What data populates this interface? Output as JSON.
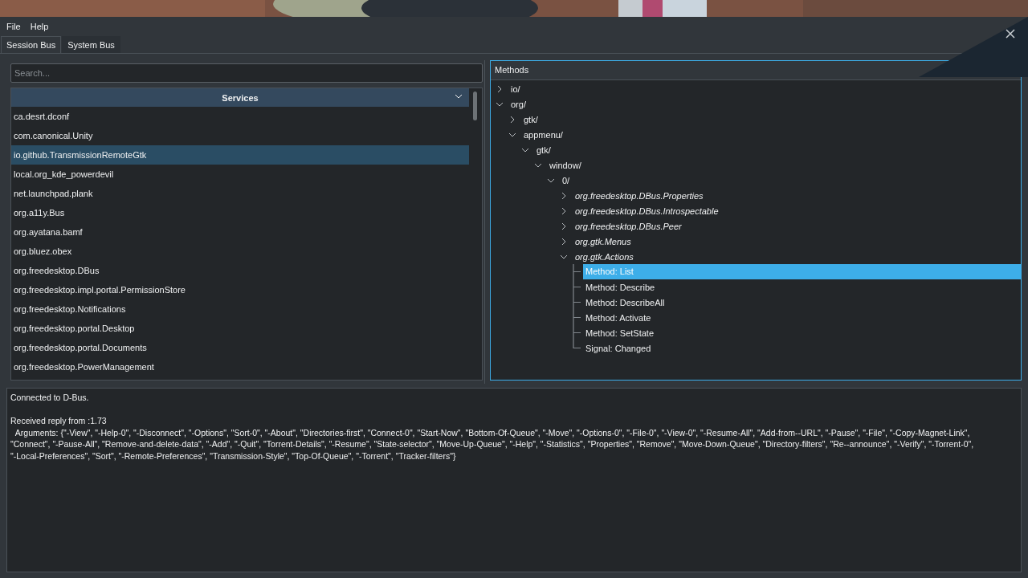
{
  "menu": [
    "File",
    "Help"
  ],
  "tabs": [
    {
      "label": "Session Bus",
      "selected": true
    },
    {
      "label": "System Bus",
      "selected": false
    }
  ],
  "search": {
    "placeholder": "Search..."
  },
  "services": {
    "header": "Services",
    "items": [
      {
        "name": "ca.desrt.dconf",
        "selected": false
      },
      {
        "name": "com.canonical.Unity",
        "selected": false
      },
      {
        "name": "io.github.TransmissionRemoteGtk",
        "selected": true
      },
      {
        "name": "local.org_kde_powerdevil",
        "selected": false
      },
      {
        "name": "net.launchpad.plank",
        "selected": false
      },
      {
        "name": "org.a11y.Bus",
        "selected": false
      },
      {
        "name": "org.ayatana.bamf",
        "selected": false
      },
      {
        "name": "org.bluez.obex",
        "selected": false
      },
      {
        "name": "org.freedesktop.DBus",
        "selected": false
      },
      {
        "name": "org.freedesktop.impl.portal.PermissionStore",
        "selected": false
      },
      {
        "name": "org.freedesktop.Notifications",
        "selected": false
      },
      {
        "name": "org.freedesktop.portal.Desktop",
        "selected": false
      },
      {
        "name": "org.freedesktop.portal.Documents",
        "selected": false
      },
      {
        "name": "org.freedesktop.PowerManagement",
        "selected": false
      }
    ]
  },
  "methods": {
    "header": "Methods",
    "tree": [
      {
        "label": "io/",
        "kind": "node",
        "expanded": false
      },
      {
        "label": "org/",
        "kind": "node",
        "expanded": true,
        "children": [
          {
            "label": "gtk/",
            "kind": "node",
            "expanded": false
          },
          {
            "label": "appmenu/",
            "kind": "node",
            "expanded": true,
            "children": [
              {
                "label": "gtk/",
                "kind": "node",
                "expanded": true,
                "children": [
                  {
                    "label": "window/",
                    "kind": "node",
                    "expanded": true,
                    "children": [
                      {
                        "label": "0/",
                        "kind": "node",
                        "expanded": true,
                        "children": [
                          {
                            "label": "org.freedesktop.DBus.Properties",
                            "kind": "interface",
                            "expanded": false
                          },
                          {
                            "label": "org.freedesktop.DBus.Introspectable",
                            "kind": "interface",
                            "expanded": false
                          },
                          {
                            "label": "org.freedesktop.DBus.Peer",
                            "kind": "interface",
                            "expanded": false
                          },
                          {
                            "label": "org.gtk.Menus",
                            "kind": "interface",
                            "expanded": false
                          },
                          {
                            "label": "org.gtk.Actions",
                            "kind": "interface",
                            "expanded": true,
                            "children": [
                              {
                                "label": "Method: List",
                                "kind": "member",
                                "selected": true
                              },
                              {
                                "label": "Method: Describe",
                                "kind": "member",
                                "selected": false
                              },
                              {
                                "label": "Method: DescribeAll",
                                "kind": "member",
                                "selected": false
                              },
                              {
                                "label": "Method: Activate",
                                "kind": "member",
                                "selected": false
                              },
                              {
                                "label": "Method: SetState",
                                "kind": "member",
                                "selected": false
                              },
                              {
                                "label": "Signal: Changed",
                                "kind": "member",
                                "selected": false
                              }
                            ]
                          }
                        ]
                      }
                    ]
                  }
                ]
              }
            ]
          }
        ]
      }
    ]
  },
  "log": [
    [
      "Connected to D-Bus."
    ],
    [
      "Received reply from :1.73",
      "  Arguments: {\"-View\", \"-Help-0\", \"-Disconnect\", \"-Options\", \"Sort-0\", \"-About\", \"Directories-first\", \"Connect-0\", \"Start-Now\", \"Bottom-Of-Queue\", \"-Move\", \"-Options-0\", \"-File-0\", \"-View-0\", \"-Resume-All\", \"Add-from--URL\", \"-Pause\", \"-File\", \"-Copy-Magnet-Link\",",
      "\"Connect\", \"-Pause-All\", \"Remove-and-delete-data\", \"-Add\", \"-Quit\", \"Torrent-Details\", \"-Resume\", \"State-selector\", \"Move-Up-Queue\", \"-Help\", \"-Statistics\", \"Properties\", \"Remove\", \"Move-Down-Queue\", \"Directory-filters\", \"Re--announce\", \"-Verify\", \"-Torrent-0\",",
      "\"-Local-Preferences\", \"Sort\", \"-Remote-Preferences\", \"Transmission-Style\", \"Top-Of-Queue\", \"-Torrent\", \"Tracker-filters\"}"
    ]
  ]
}
